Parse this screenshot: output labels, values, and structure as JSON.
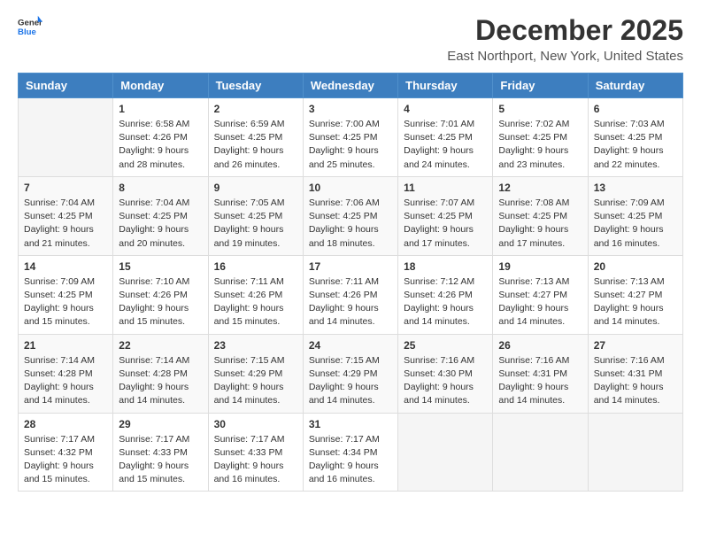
{
  "logo": {
    "general": "General",
    "blue": "Blue"
  },
  "title": "December 2025",
  "subtitle": "East Northport, New York, United States",
  "days_of_week": [
    "Sunday",
    "Monday",
    "Tuesday",
    "Wednesday",
    "Thursday",
    "Friday",
    "Saturday"
  ],
  "weeks": [
    [
      {
        "day": "",
        "sunrise": "",
        "sunset": "",
        "daylight": "",
        "empty": true
      },
      {
        "day": "1",
        "sunrise": "Sunrise: 6:58 AM",
        "sunset": "Sunset: 4:26 PM",
        "daylight": "Daylight: 9 hours and 28 minutes."
      },
      {
        "day": "2",
        "sunrise": "Sunrise: 6:59 AM",
        "sunset": "Sunset: 4:25 PM",
        "daylight": "Daylight: 9 hours and 26 minutes."
      },
      {
        "day": "3",
        "sunrise": "Sunrise: 7:00 AM",
        "sunset": "Sunset: 4:25 PM",
        "daylight": "Daylight: 9 hours and 25 minutes."
      },
      {
        "day": "4",
        "sunrise": "Sunrise: 7:01 AM",
        "sunset": "Sunset: 4:25 PM",
        "daylight": "Daylight: 9 hours and 24 minutes."
      },
      {
        "day": "5",
        "sunrise": "Sunrise: 7:02 AM",
        "sunset": "Sunset: 4:25 PM",
        "daylight": "Daylight: 9 hours and 23 minutes."
      },
      {
        "day": "6",
        "sunrise": "Sunrise: 7:03 AM",
        "sunset": "Sunset: 4:25 PM",
        "daylight": "Daylight: 9 hours and 22 minutes."
      }
    ],
    [
      {
        "day": "7",
        "sunrise": "Sunrise: 7:04 AM",
        "sunset": "Sunset: 4:25 PM",
        "daylight": "Daylight: 9 hours and 21 minutes."
      },
      {
        "day": "8",
        "sunrise": "Sunrise: 7:04 AM",
        "sunset": "Sunset: 4:25 PM",
        "daylight": "Daylight: 9 hours and 20 minutes."
      },
      {
        "day": "9",
        "sunrise": "Sunrise: 7:05 AM",
        "sunset": "Sunset: 4:25 PM",
        "daylight": "Daylight: 9 hours and 19 minutes."
      },
      {
        "day": "10",
        "sunrise": "Sunrise: 7:06 AM",
        "sunset": "Sunset: 4:25 PM",
        "daylight": "Daylight: 9 hours and 18 minutes."
      },
      {
        "day": "11",
        "sunrise": "Sunrise: 7:07 AM",
        "sunset": "Sunset: 4:25 PM",
        "daylight": "Daylight: 9 hours and 17 minutes."
      },
      {
        "day": "12",
        "sunrise": "Sunrise: 7:08 AM",
        "sunset": "Sunset: 4:25 PM",
        "daylight": "Daylight: 9 hours and 17 minutes."
      },
      {
        "day": "13",
        "sunrise": "Sunrise: 7:09 AM",
        "sunset": "Sunset: 4:25 PM",
        "daylight": "Daylight: 9 hours and 16 minutes."
      }
    ],
    [
      {
        "day": "14",
        "sunrise": "Sunrise: 7:09 AM",
        "sunset": "Sunset: 4:25 PM",
        "daylight": "Daylight: 9 hours and 15 minutes."
      },
      {
        "day": "15",
        "sunrise": "Sunrise: 7:10 AM",
        "sunset": "Sunset: 4:26 PM",
        "daylight": "Daylight: 9 hours and 15 minutes."
      },
      {
        "day": "16",
        "sunrise": "Sunrise: 7:11 AM",
        "sunset": "Sunset: 4:26 PM",
        "daylight": "Daylight: 9 hours and 15 minutes."
      },
      {
        "day": "17",
        "sunrise": "Sunrise: 7:11 AM",
        "sunset": "Sunset: 4:26 PM",
        "daylight": "Daylight: 9 hours and 14 minutes."
      },
      {
        "day": "18",
        "sunrise": "Sunrise: 7:12 AM",
        "sunset": "Sunset: 4:26 PM",
        "daylight": "Daylight: 9 hours and 14 minutes."
      },
      {
        "day": "19",
        "sunrise": "Sunrise: 7:13 AM",
        "sunset": "Sunset: 4:27 PM",
        "daylight": "Daylight: 9 hours and 14 minutes."
      },
      {
        "day": "20",
        "sunrise": "Sunrise: 7:13 AM",
        "sunset": "Sunset: 4:27 PM",
        "daylight": "Daylight: 9 hours and 14 minutes."
      }
    ],
    [
      {
        "day": "21",
        "sunrise": "Sunrise: 7:14 AM",
        "sunset": "Sunset: 4:28 PM",
        "daylight": "Daylight: 9 hours and 14 minutes."
      },
      {
        "day": "22",
        "sunrise": "Sunrise: 7:14 AM",
        "sunset": "Sunset: 4:28 PM",
        "daylight": "Daylight: 9 hours and 14 minutes."
      },
      {
        "day": "23",
        "sunrise": "Sunrise: 7:15 AM",
        "sunset": "Sunset: 4:29 PM",
        "daylight": "Daylight: 9 hours and 14 minutes."
      },
      {
        "day": "24",
        "sunrise": "Sunrise: 7:15 AM",
        "sunset": "Sunset: 4:29 PM",
        "daylight": "Daylight: 9 hours and 14 minutes."
      },
      {
        "day": "25",
        "sunrise": "Sunrise: 7:16 AM",
        "sunset": "Sunset: 4:30 PM",
        "daylight": "Daylight: 9 hours and 14 minutes."
      },
      {
        "day": "26",
        "sunrise": "Sunrise: 7:16 AM",
        "sunset": "Sunset: 4:31 PM",
        "daylight": "Daylight: 9 hours and 14 minutes."
      },
      {
        "day": "27",
        "sunrise": "Sunrise: 7:16 AM",
        "sunset": "Sunset: 4:31 PM",
        "daylight": "Daylight: 9 hours and 14 minutes."
      }
    ],
    [
      {
        "day": "28",
        "sunrise": "Sunrise: 7:17 AM",
        "sunset": "Sunset: 4:32 PM",
        "daylight": "Daylight: 9 hours and 15 minutes."
      },
      {
        "day": "29",
        "sunrise": "Sunrise: 7:17 AM",
        "sunset": "Sunset: 4:33 PM",
        "daylight": "Daylight: 9 hours and 15 minutes."
      },
      {
        "day": "30",
        "sunrise": "Sunrise: 7:17 AM",
        "sunset": "Sunset: 4:33 PM",
        "daylight": "Daylight: 9 hours and 16 minutes."
      },
      {
        "day": "31",
        "sunrise": "Sunrise: 7:17 AM",
        "sunset": "Sunset: 4:34 PM",
        "daylight": "Daylight: 9 hours and 16 minutes."
      },
      {
        "day": "",
        "sunrise": "",
        "sunset": "",
        "daylight": "",
        "empty": true
      },
      {
        "day": "",
        "sunrise": "",
        "sunset": "",
        "daylight": "",
        "empty": true
      },
      {
        "day": "",
        "sunrise": "",
        "sunset": "",
        "daylight": "",
        "empty": true
      }
    ]
  ]
}
